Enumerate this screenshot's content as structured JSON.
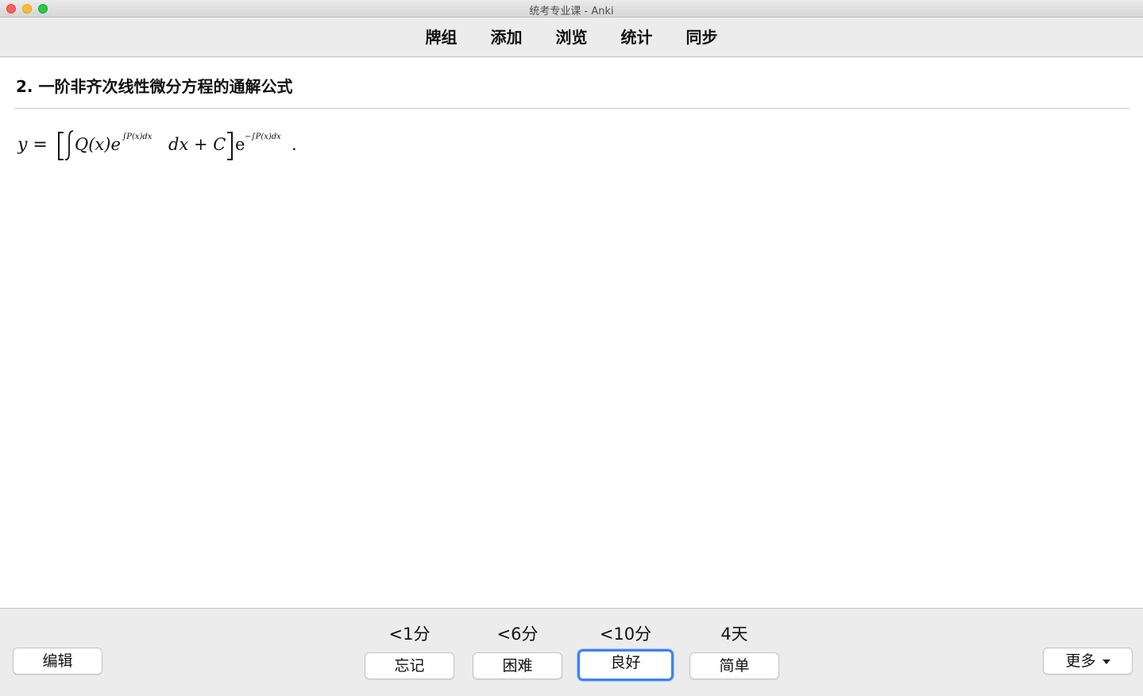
{
  "window": {
    "title": "统考专业课 - Anki"
  },
  "toolbar": {
    "items": [
      {
        "label": "牌组"
      },
      {
        "label": "添加"
      },
      {
        "label": "浏览"
      },
      {
        "label": "统计"
      },
      {
        "label": "同步"
      }
    ]
  },
  "card": {
    "title": "2. 一阶非齐次线性微分方程的通解公式",
    "formula": {
      "lhs": "y =",
      "term1": "Q(x)e",
      "exp1": "∫P(x)dx",
      "dx": "dx + C",
      "term2": "e",
      "exp2": "−∫P(x)dx",
      "end": "."
    }
  },
  "bottom": {
    "edit_label": "编辑",
    "more_label": "更多",
    "ease": [
      {
        "interval": "<1分",
        "label": "忘记"
      },
      {
        "interval": "<6分",
        "label": "困难"
      },
      {
        "interval": "<10分",
        "label": "良好",
        "focused": true
      },
      {
        "interval": "4天",
        "label": "简单"
      }
    ]
  },
  "colors": {
    "focus_ring": "#3a82f7",
    "background": "#ececec"
  }
}
